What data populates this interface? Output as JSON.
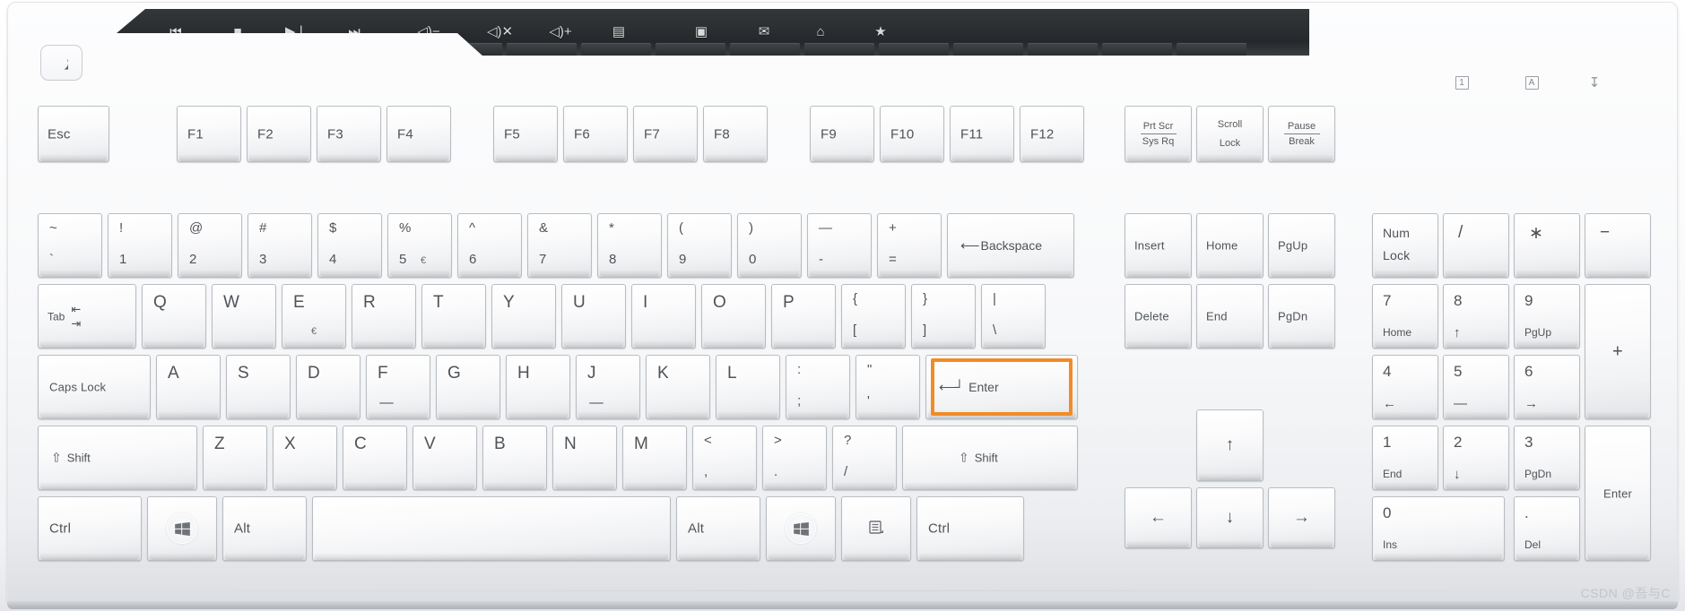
{
  "device": {
    "type": "desktop-keyboard",
    "layout": "ANSI 104-key with media row",
    "color": "#f4f5f7",
    "highlight_color": "#f08c28",
    "watermark": "CSDN @吾与C"
  },
  "media_bar": {
    "buttons": [
      {
        "name": "previous-track",
        "glyph": "⏮"
      },
      {
        "name": "stop",
        "glyph": "■"
      },
      {
        "name": "play-pause",
        "glyph": "▶❘"
      },
      {
        "name": "next-track",
        "glyph": "⏭"
      },
      {
        "name": "volume-down",
        "glyph": "◁)−"
      },
      {
        "name": "mute",
        "glyph": "◁)✕"
      },
      {
        "name": "volume-up",
        "glyph": "◁)+"
      },
      {
        "name": "calculator",
        "glyph": "▤"
      },
      {
        "name": "my-computer",
        "glyph": "▣"
      },
      {
        "name": "email",
        "glyph": "✉"
      },
      {
        "name": "home-page",
        "glyph": "⌂"
      },
      {
        "name": "favorites",
        "glyph": "★"
      }
    ]
  },
  "sleep_button": {
    "label": "",
    "icon": "moon-icon"
  },
  "indicators": [
    {
      "name": "num-lock-indicator",
      "glyph": "1"
    },
    {
      "name": "caps-lock-indicator",
      "glyph": "A"
    },
    {
      "name": "scroll-lock-indicator",
      "glyph": "↧"
    }
  ],
  "rows": {
    "function_row": [
      {
        "name": "esc",
        "label": "Esc"
      },
      {
        "name": "f1",
        "label": "F1"
      },
      {
        "name": "f2",
        "label": "F2"
      },
      {
        "name": "f3",
        "label": "F3"
      },
      {
        "name": "f4",
        "label": "F4"
      },
      {
        "name": "f5",
        "label": "F5"
      },
      {
        "name": "f6",
        "label": "F6"
      },
      {
        "name": "f7",
        "label": "F7"
      },
      {
        "name": "f8",
        "label": "F8"
      },
      {
        "name": "f9",
        "label": "F9"
      },
      {
        "name": "f10",
        "label": "F10"
      },
      {
        "name": "f11",
        "label": "F11"
      },
      {
        "name": "f12",
        "label": "F12"
      }
    ],
    "system_keys": [
      {
        "name": "print-screen",
        "top": "Prt Scr",
        "bottom": "Sys Rq",
        "divider": true
      },
      {
        "name": "scroll-lock",
        "top": "Scroll",
        "bottom": "Lock",
        "divider": false
      },
      {
        "name": "pause-break",
        "top": "Pause",
        "bottom": "Break",
        "divider": true
      }
    ],
    "number_row": [
      {
        "name": "backtick",
        "top": "~",
        "bottom": "`"
      },
      {
        "name": "digit-1",
        "top": "!",
        "bottom": "1"
      },
      {
        "name": "digit-2",
        "top": "@",
        "bottom": "2"
      },
      {
        "name": "digit-3",
        "top": "#",
        "bottom": "3"
      },
      {
        "name": "digit-4",
        "top": "$",
        "bottom": "4"
      },
      {
        "name": "digit-5",
        "top": "%",
        "bottom": "5",
        "extra": "€"
      },
      {
        "name": "digit-6",
        "top": "^",
        "bottom": "6"
      },
      {
        "name": "digit-7",
        "top": "&",
        "bottom": "7"
      },
      {
        "name": "digit-8",
        "top": "*",
        "bottom": "8"
      },
      {
        "name": "digit-9",
        "top": "(",
        "bottom": "9"
      },
      {
        "name": "digit-0",
        "top": ")",
        "bottom": "0"
      },
      {
        "name": "minus",
        "top": "—",
        "bottom": "-"
      },
      {
        "name": "equals",
        "top": "+",
        "bottom": "="
      }
    ],
    "backspace": {
      "name": "backspace",
      "label": "Backspace",
      "arrow": "⟵"
    },
    "tab": {
      "name": "tab",
      "label": "Tab",
      "arrow_left": "⇤",
      "arrow_right": "⇥"
    },
    "qwerty_row": [
      {
        "name": "q",
        "label": "Q"
      },
      {
        "name": "w",
        "label": "W"
      },
      {
        "name": "e",
        "label": "E",
        "extra": "€"
      },
      {
        "name": "r",
        "label": "R"
      },
      {
        "name": "t",
        "label": "T"
      },
      {
        "name": "y",
        "label": "Y"
      },
      {
        "name": "u",
        "label": "U"
      },
      {
        "name": "i",
        "label": "I"
      },
      {
        "name": "o",
        "label": "O"
      },
      {
        "name": "p",
        "label": "P"
      },
      {
        "name": "bracket-left",
        "top": "{",
        "bottom": "["
      },
      {
        "name": "bracket-right",
        "top": "}",
        "bottom": "]"
      },
      {
        "name": "backslash",
        "top": "|",
        "bottom": "\\"
      }
    ],
    "caps_lock": {
      "name": "caps-lock",
      "label": "Caps Lock"
    },
    "home_row": [
      {
        "name": "a",
        "label": "A"
      },
      {
        "name": "s",
        "label": "S"
      },
      {
        "name": "d",
        "label": "D"
      },
      {
        "name": "f",
        "label": "F",
        "homing": true
      },
      {
        "name": "g",
        "label": "G"
      },
      {
        "name": "h",
        "label": "H"
      },
      {
        "name": "j",
        "label": "J",
        "homing": true
      },
      {
        "name": "k",
        "label": "K"
      },
      {
        "name": "l",
        "label": "L"
      },
      {
        "name": "semicolon",
        "top": ":",
        "bottom": ";"
      },
      {
        "name": "quote",
        "top": "\"",
        "bottom": "'"
      }
    ],
    "enter": {
      "name": "enter",
      "label": "Enter",
      "arrow": "↵",
      "highlighted": true
    },
    "shift_left": {
      "name": "shift-left",
      "label": "Shift",
      "arrow": "⇧"
    },
    "shift_right": {
      "name": "shift-right",
      "label": "Shift",
      "arrow": "⇧"
    },
    "zxc_row": [
      {
        "name": "z",
        "label": "Z"
      },
      {
        "name": "x",
        "label": "X"
      },
      {
        "name": "c",
        "label": "C"
      },
      {
        "name": "v",
        "label": "V"
      },
      {
        "name": "b",
        "label": "B"
      },
      {
        "name": "n",
        "label": "N"
      },
      {
        "name": "m",
        "label": "M"
      },
      {
        "name": "comma",
        "top": "<",
        "bottom": ","
      },
      {
        "name": "period",
        "top": ">",
        "bottom": "."
      },
      {
        "name": "slash",
        "top": "?",
        "bottom": "/"
      }
    ],
    "bottom_row": [
      {
        "name": "ctrl-left",
        "label": "Ctrl"
      },
      {
        "name": "win-left",
        "label": "",
        "icon": "windows-icon"
      },
      {
        "name": "alt-left",
        "label": "Alt"
      },
      {
        "name": "space",
        "label": ""
      },
      {
        "name": "alt-right",
        "label": "Alt"
      },
      {
        "name": "win-right",
        "label": "",
        "icon": "windows-icon"
      },
      {
        "name": "menu",
        "label": "",
        "icon": "menu-icon"
      },
      {
        "name": "ctrl-right",
        "label": "Ctrl"
      }
    ]
  },
  "nav_cluster": [
    {
      "name": "insert",
      "label": "Insert"
    },
    {
      "name": "home",
      "label": "Home"
    },
    {
      "name": "page-up",
      "label": "PgUp"
    },
    {
      "name": "delete",
      "label": "Delete"
    },
    {
      "name": "end",
      "label": "End"
    },
    {
      "name": "page-down",
      "label": "PgDn"
    }
  ],
  "arrow_cluster": [
    {
      "name": "arrow-up",
      "glyph": "↑"
    },
    {
      "name": "arrow-left",
      "glyph": "←"
    },
    {
      "name": "arrow-down",
      "glyph": "↓"
    },
    {
      "name": "arrow-right",
      "glyph": "→"
    }
  ],
  "numpad": {
    "row1": [
      {
        "name": "num-lock",
        "top": "Num",
        "bottom": "Lock"
      },
      {
        "name": "numpad-divide",
        "label": "/"
      },
      {
        "name": "numpad-multiply",
        "label": "∗"
      },
      {
        "name": "numpad-subtract",
        "label": "−"
      }
    ],
    "row2": [
      {
        "name": "numpad-7",
        "num": "7",
        "sub": "Home"
      },
      {
        "name": "numpad-8",
        "num": "8",
        "sub": "↑"
      },
      {
        "name": "numpad-9",
        "num": "9",
        "sub": "PgUp"
      }
    ],
    "plus": {
      "name": "numpad-add",
      "label": "+"
    },
    "row3": [
      {
        "name": "numpad-4",
        "num": "4",
        "sub": "←"
      },
      {
        "name": "numpad-5",
        "num": "5",
        "sub": "—"
      },
      {
        "name": "numpad-6",
        "num": "6",
        "sub": "→"
      }
    ],
    "row4": [
      {
        "name": "numpad-1",
        "num": "1",
        "sub": "End"
      },
      {
        "name": "numpad-2",
        "num": "2",
        "sub": "↓"
      },
      {
        "name": "numpad-3",
        "num": "3",
        "sub": "PgDn"
      }
    ],
    "row5": [
      {
        "name": "numpad-0",
        "num": "0",
        "sub": "Ins"
      },
      {
        "name": "numpad-decimal",
        "num": ".",
        "sub": "Del"
      }
    ],
    "enter": {
      "name": "numpad-enter",
      "label": "Enter"
    }
  }
}
